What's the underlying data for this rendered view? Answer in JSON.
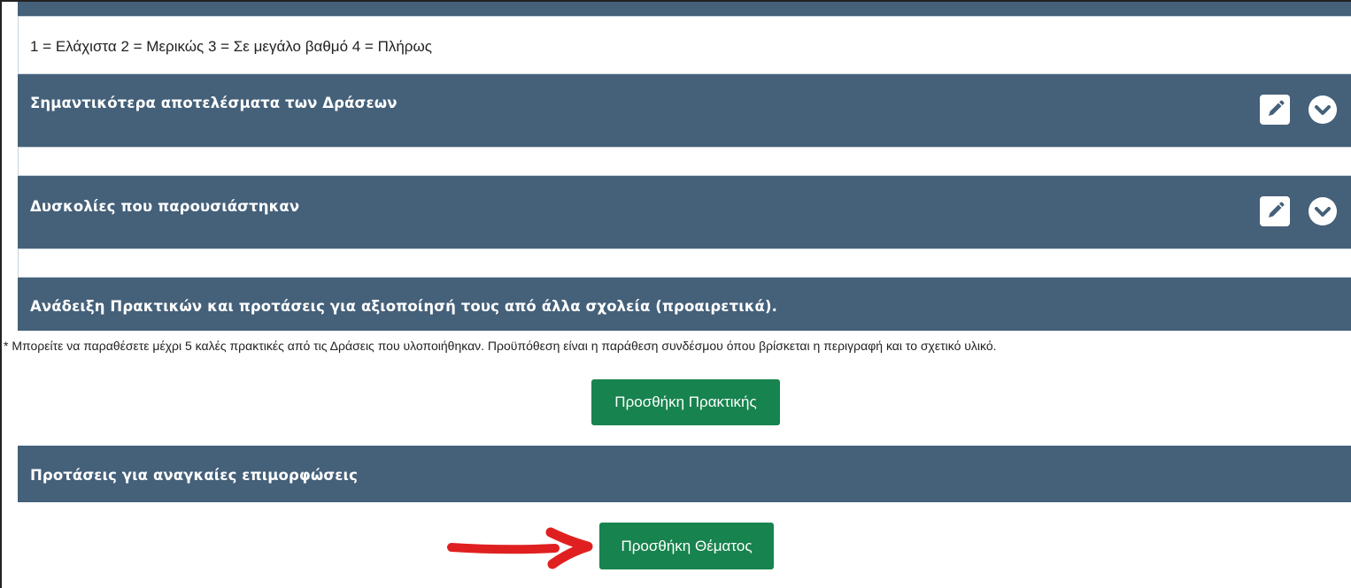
{
  "scale_legend": "1 = Ελάχιστα 2 = Μερικώς 3 = Σε μεγάλο βαθμό 4 = Πλήρως",
  "sections": {
    "results": {
      "title": "Σημαντικότερα αποτελέσματα των Δράσεων"
    },
    "difficulties": {
      "title": "Δυσκολίες που παρουσιάστηκαν"
    },
    "practices": {
      "title": "Ανάδειξη Πρακτικών και προτάσεις για αξιοποίησή τους από άλλα σχολεία (προαιρετικά).",
      "note": "* Μπορείτε να παραθέσετε μέχρι 5 καλές πρακτικές από τις Δράσεις που υλοποιήθηκαν. Προϋπόθεση είναι η παράθεση συνδέσμου όπου βρίσκεται η περιγραφή και το σχετικό υλικό.",
      "add_button": "Προσθήκη Πρακτικής"
    },
    "trainings": {
      "title": "Προτάσεις για αναγκαίες επιμορφώσεις",
      "add_button": "Προσθήκη Θέματος"
    }
  },
  "icons": {
    "edit": "pencil-icon",
    "expand": "chevron-down-icon",
    "annotation": "red-arrow-icon"
  },
  "colors": {
    "header_bar": "#456079",
    "action_button": "#17834e",
    "annotation_arrow": "#e02020"
  }
}
